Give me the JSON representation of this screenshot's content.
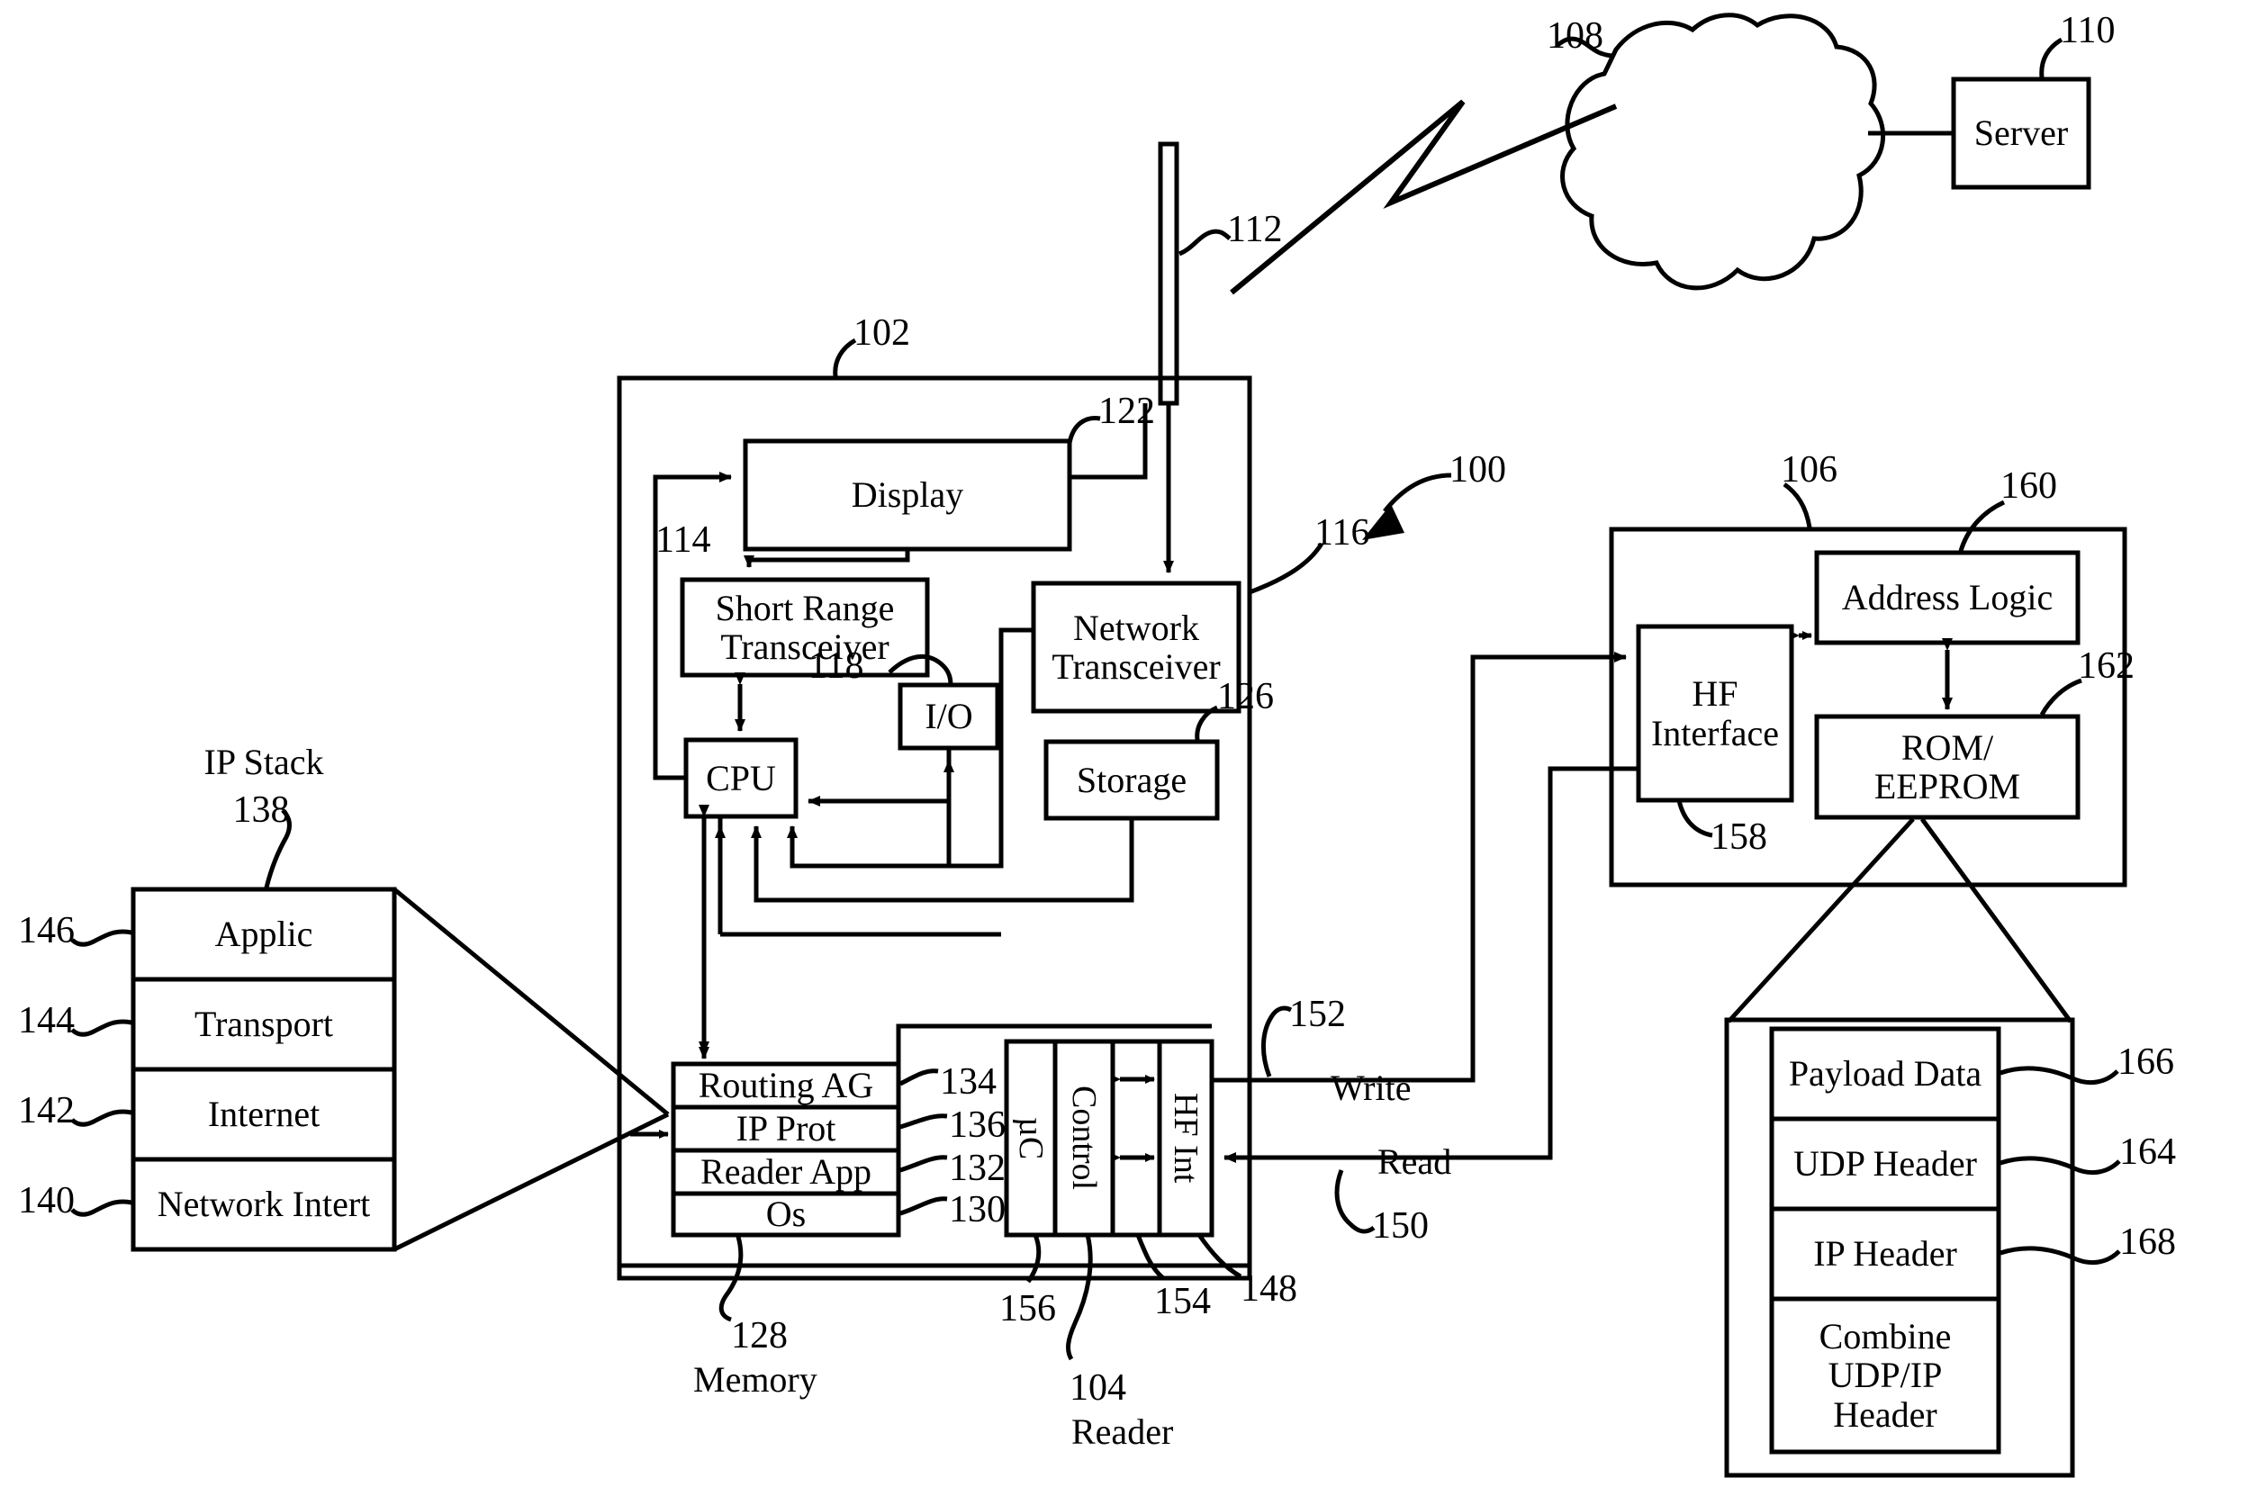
{
  "figure": {
    "system_ref": "100",
    "device_ref": "102",
    "reader_ref": "104",
    "reader_caption": "Reader",
    "tag_ref": "106",
    "cloud_ref": "108",
    "server_ref": "110",
    "server_label": "Server",
    "antenna_ref": "112"
  },
  "device": {
    "ref": "102",
    "blocks": {
      "display": {
        "label": "Display",
        "ref": "122"
      },
      "short_range_transceiver": {
        "label": "Short Range\nTransceiver",
        "ref": "114"
      },
      "network_transceiver": {
        "label": "Network\nTransceiver",
        "ref": "116"
      },
      "io": {
        "label": "I/O",
        "ref": "118"
      },
      "cpu": {
        "label": "CPU"
      },
      "storage": {
        "label": "Storage",
        "ref": "126"
      }
    },
    "memory": {
      "caption": "Memory",
      "ref": "128",
      "layers": [
        {
          "label": "Routing AG",
          "ref": "134"
        },
        {
          "label": "IP Prot",
          "ref": "136"
        },
        {
          "label": "Reader App",
          "ref": "132"
        },
        {
          "label": "Os",
          "ref": "130"
        }
      ]
    }
  },
  "reader": {
    "ref": "104",
    "caption": "Reader",
    "columns": [
      {
        "label": "µC",
        "ref": "156"
      },
      {
        "label": "Control",
        "ref": ""
      },
      {
        "label": "",
        "ref": "154"
      },
      {
        "label": "HF Int",
        "ref": "148"
      }
    ],
    "links": {
      "write_label": "Write",
      "write_ref": "152",
      "read_label": "Read",
      "read_ref": "150"
    }
  },
  "tag": {
    "ref": "106",
    "blocks": {
      "hf_interface": {
        "label": "HF\nInterface",
        "ref": "158"
      },
      "address_logic": {
        "label": "Address Logic",
        "ref": "160"
      },
      "rom_eeprom": {
        "label": "ROM/\nEEPROM",
        "ref": "162"
      }
    }
  },
  "ip_stack": {
    "title": "IP Stack",
    "ref": "138",
    "layers": [
      {
        "label": "Applic",
        "ref": "146"
      },
      {
        "label": "Transport",
        "ref": "144"
      },
      {
        "label": "Internet",
        "ref": "142"
      },
      {
        "label": "Network Intert",
        "ref": "140"
      }
    ]
  },
  "packet": {
    "fields": [
      {
        "label": "Payload Data",
        "ref": "166"
      },
      {
        "label": "UDP Header",
        "ref": "164"
      },
      {
        "label": "IP Header",
        "ref": "168"
      },
      {
        "label": "Combine\nUDP/IP\nHeader",
        "ref": ""
      }
    ]
  }
}
